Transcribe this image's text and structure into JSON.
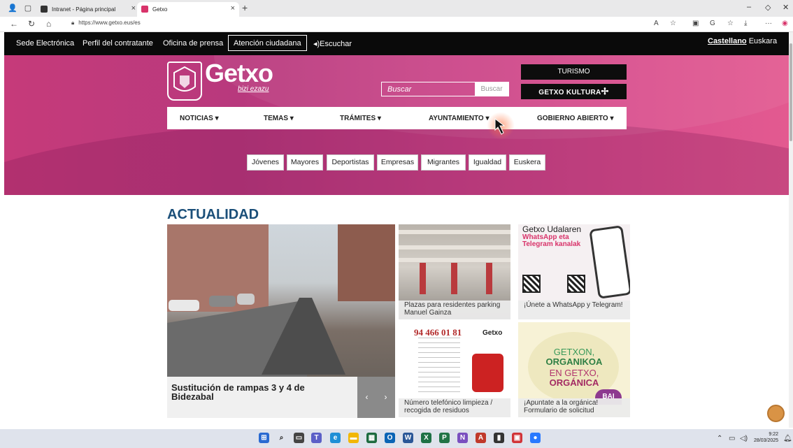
{
  "browser": {
    "tabs": [
      {
        "title": "Intranet - Página principal"
      },
      {
        "title": "Getxo"
      }
    ],
    "url": "https://www.getxo.eus/es"
  },
  "topbar": {
    "links": [
      "Sede Electrónica",
      "Perfil del contratante",
      "Oficina de prensa"
    ],
    "boxed": "Atención ciudadana",
    "listen": "◂)Escuchar",
    "lang_active": "Castellano",
    "lang_other": "Euskara"
  },
  "hero": {
    "logo_text": "Getxo",
    "logo_tagline": "bizi ezazu",
    "search_placeholder": "Buscar",
    "search_button": "Buscar",
    "turismo": "TURISMO",
    "kultura": "GETXO KULTURA",
    "nav": [
      "NOTICIAS",
      "TEMAS",
      "TRÁMITES",
      "AYUNTAMIENTO",
      "GOBIERNO ABIERTO"
    ],
    "chips": [
      "Jóvenes",
      "Mayores",
      "Deportistas",
      "Empresas",
      "Migrantes",
      "Igualdad",
      "Euskera"
    ]
  },
  "news": {
    "section_title": "ACTUALIDAD",
    "featured": "Sustitución de rampas 3 y 4 de Bidezabal",
    "cards": [
      {
        "caption": "Plazas para residentes parking Manuel Gainza"
      },
      {
        "caption": "¡Únete a WhatsApp y Telegram!",
        "heading": "Getxo Udalaren",
        "heading2": "WhatsApp eta Telegram kanalak"
      },
      {
        "caption": "Número telefónico limpieza / recogida de residuos",
        "phone": "94 466 01 81",
        "logo": "Getxo"
      },
      {
        "caption": "¡Apuntate a la orgánica! Formulario de solicitud",
        "l1": "GETXON,",
        "l2": "ORGANIKOA",
        "l3": "EN GETXO,",
        "l4": "ORGÁNICA",
        "badge": "BAI"
      }
    ]
  },
  "taskbar": {
    "time": "9:22",
    "date": "28/03/2025"
  },
  "colors": {
    "hero_pink": "#c63a7a",
    "title_blue": "#1b4f79",
    "black_bar": "#0a0a0a"
  }
}
